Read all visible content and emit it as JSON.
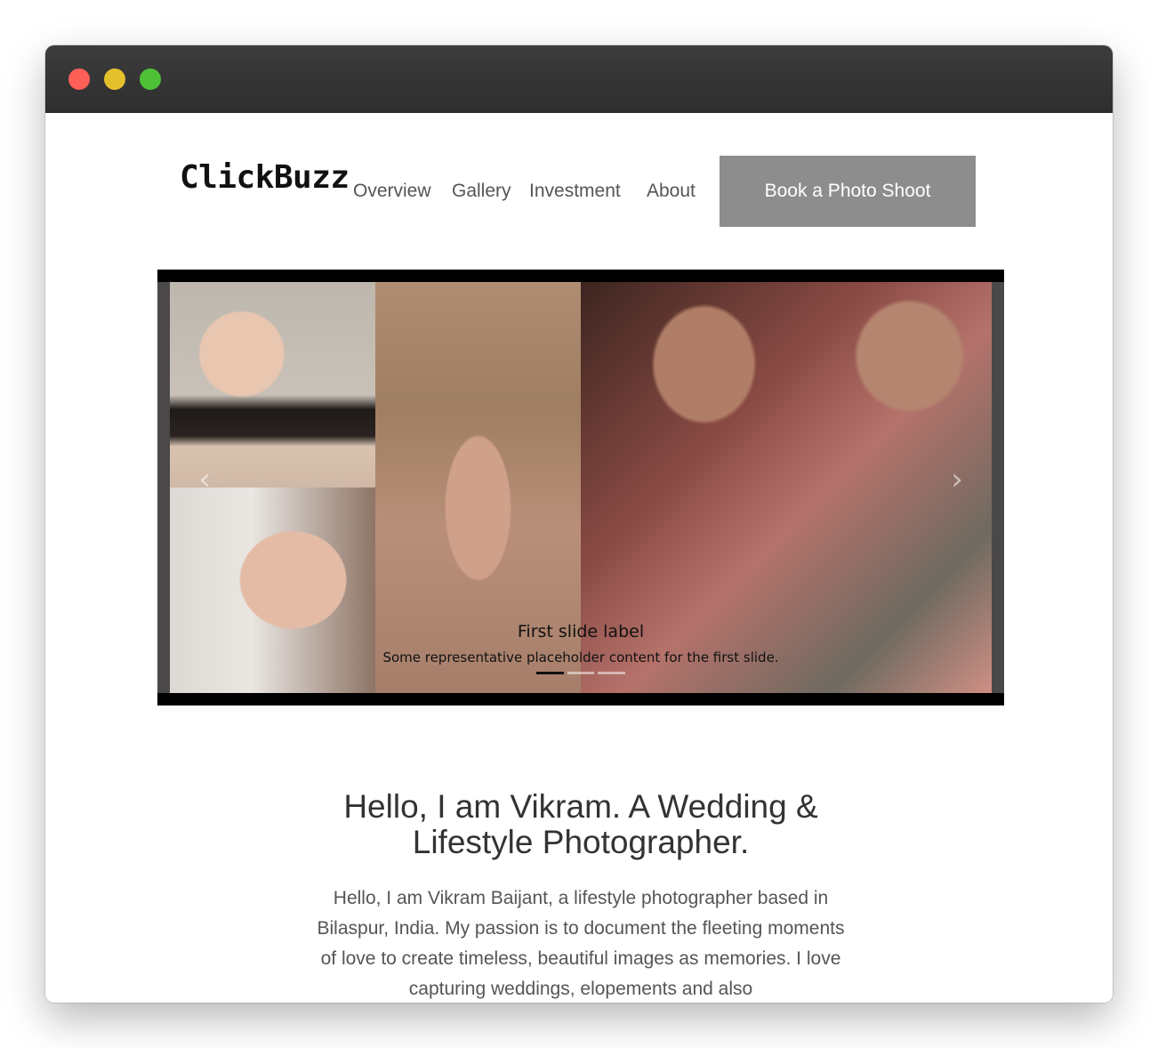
{
  "brand": {
    "name": "ClickBuzz"
  },
  "nav": {
    "items": [
      "Overview",
      "Gallery",
      "Investment",
      "About"
    ],
    "cta_label": "Book a Photo Shoot"
  },
  "carousel": {
    "slide_title": "First slide label",
    "slide_text": "Some representative placeholder content for the first slide.",
    "prev_icon": "chevron-left-icon",
    "next_icon": "chevron-right-icon",
    "indicator_count": 3,
    "active_index": 0
  },
  "intro": {
    "heading": "Hello, I am Vikram. A Wedding & Lifestyle Photographer.",
    "bio": "Hello, I am Vikram Baijant, a lifestyle photographer based in Bilaspur, India. My passion is to document the fleeting moments of love to create timeless, beautiful images as memories. I love capturing weddings, elopements and also"
  },
  "colors": {
    "titlebar": "#333333",
    "cta_background": "#8e8d8e",
    "traffic_red": "#fe5f57",
    "traffic_yellow": "#e5c02d",
    "traffic_green": "#4ec137"
  }
}
